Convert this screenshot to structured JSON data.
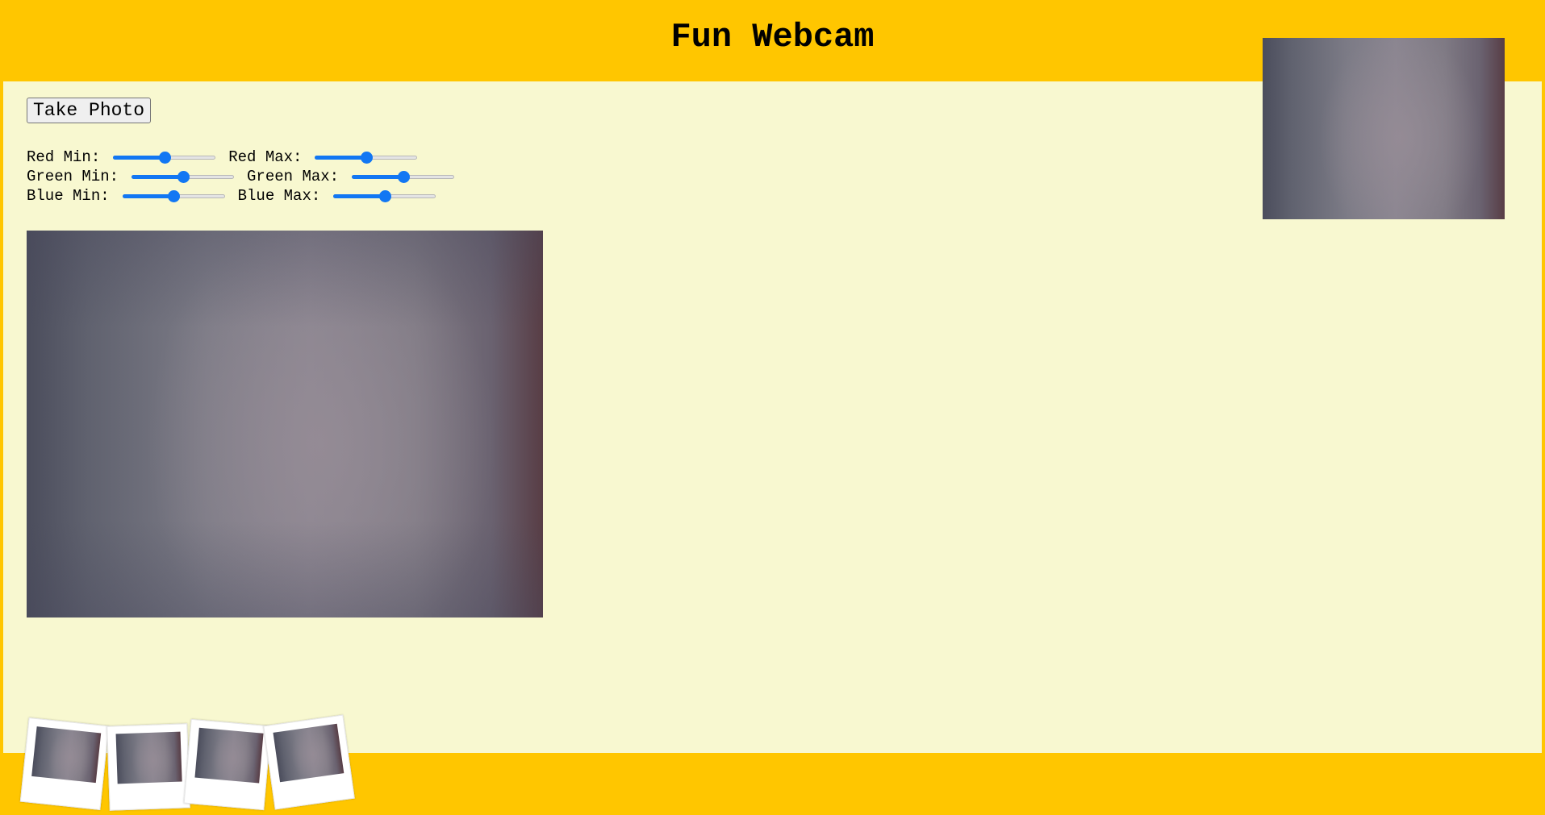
{
  "header": {
    "title": "Fun Webcam"
  },
  "toolbar": {
    "take_photo_label": "Take Photo"
  },
  "controls": {
    "red_min": {
      "label": "Red Min:",
      "value": 0.5
    },
    "red_max": {
      "label": "Red Max:",
      "value": 0.5
    },
    "green_min": {
      "label": "Green Min:",
      "value": 0.5
    },
    "green_max": {
      "label": "Green Max:",
      "value": 0.5
    },
    "blue_min": {
      "label": "Blue Min:",
      "value": 0.5
    },
    "blue_max": {
      "label": "Blue Max:",
      "value": 0.5
    }
  },
  "photos": {
    "count": 4
  },
  "colors": {
    "frame": "#ffc600",
    "background": "#f8f8d0",
    "slider_accent": "#1277f3"
  }
}
